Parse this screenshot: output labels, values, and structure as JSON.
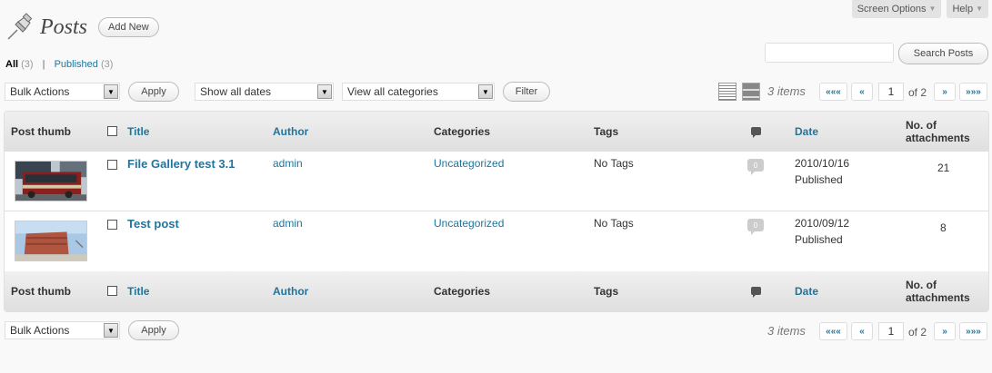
{
  "top_tabs": {
    "screen_options": "Screen Options",
    "help": "Help"
  },
  "header": {
    "title": "Posts",
    "add_new": "Add New"
  },
  "search": {
    "button": "Search Posts",
    "value": ""
  },
  "filters": {
    "all_label": "All",
    "all_count": "(3)",
    "separator": "|",
    "published_label": "Published",
    "published_count": "(3)"
  },
  "toolbar_top": {
    "bulk_actions": "Bulk Actions",
    "apply": "Apply",
    "dates": "Show all dates",
    "categories": "View all categories",
    "filter": "Filter"
  },
  "pagination": {
    "items": "3 items",
    "first": "«««",
    "prev": "«",
    "current": "1",
    "of_total": "of 2",
    "next": "»",
    "last": "»»»"
  },
  "columns": {
    "thumb": "Post thumb",
    "title": "Title",
    "author": "Author",
    "categories": "Categories",
    "tags": "Tags",
    "date": "Date",
    "attachments": "No. of attachments"
  },
  "posts": [
    {
      "title": "File Gallery test 3.1",
      "author": "admin",
      "category": "Uncategorized",
      "tags": "No Tags",
      "comments": "0",
      "date": "2010/10/16",
      "status": "Published",
      "attachments": "21"
    },
    {
      "title": "Test post",
      "author": "admin",
      "category": "Uncategorized",
      "tags": "No Tags",
      "comments": "0",
      "date": "2010/09/12",
      "status": "Published",
      "attachments": "8"
    }
  ],
  "toolbar_bottom": {
    "bulk_actions": "Bulk Actions",
    "apply": "Apply"
  },
  "icons": {
    "page": "pushpin-icon",
    "comments": "comment-bubble-icon"
  }
}
